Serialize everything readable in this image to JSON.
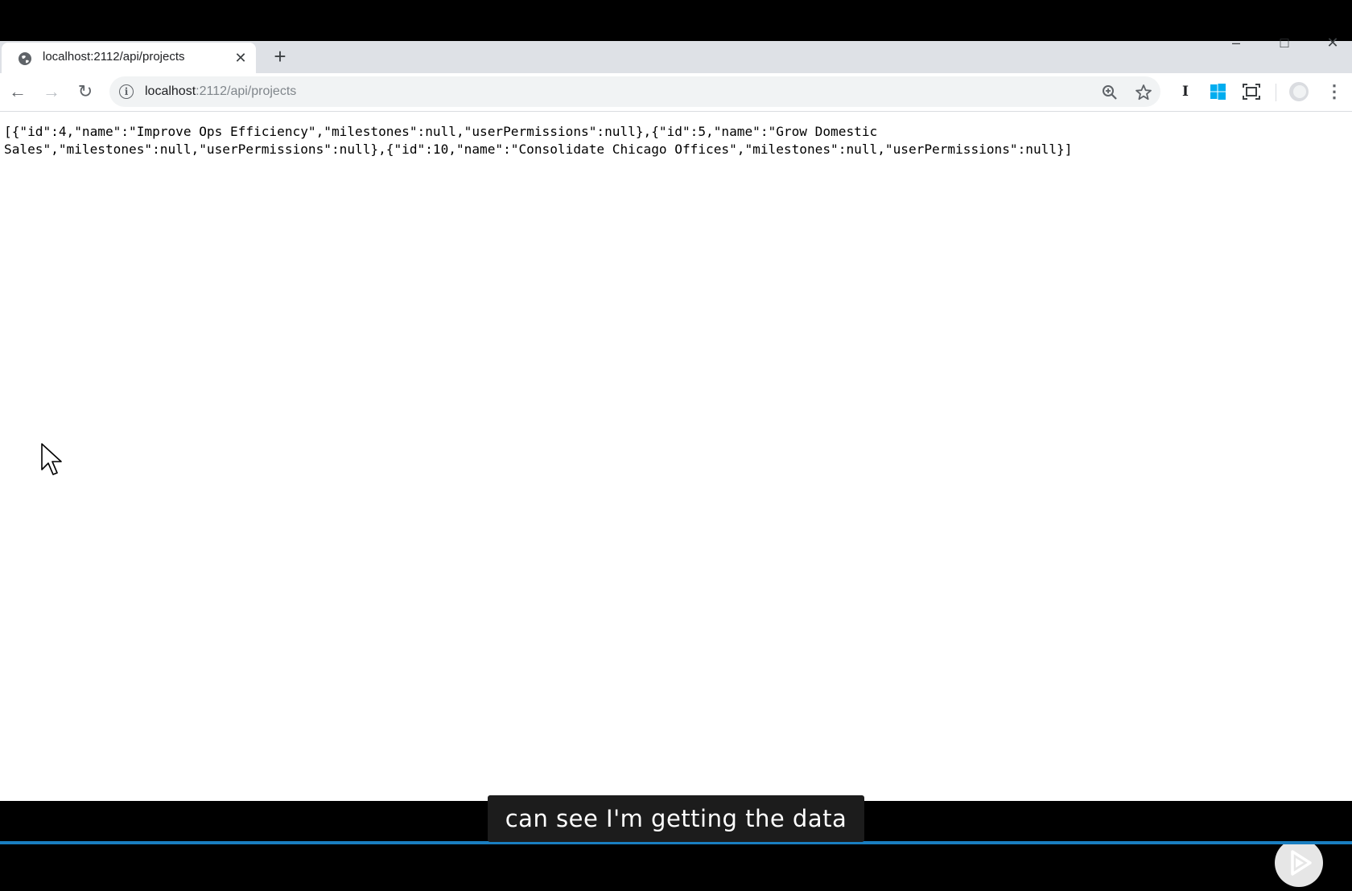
{
  "browser": {
    "tab": {
      "title": "localhost:2112/api/projects",
      "close_glyph": "✕",
      "favicon": "globe-icon"
    },
    "new_tab_glyph": "+",
    "window_controls": {
      "minimize": "–",
      "maximize": "□",
      "close": "✕"
    },
    "nav": {
      "back": "←",
      "forward": "→",
      "reload": "↻"
    },
    "address": {
      "host": "localhost",
      "path": ":2112/api/projects",
      "info_glyph": "i"
    },
    "extensions": {
      "ext_i_label": "I"
    }
  },
  "page": {
    "json_text": "[{\"id\":4,\"name\":\"Improve Ops Efficiency\",\"milestones\":null,\"userPermissions\":null},{\"id\":5,\"name\":\"Grow Domestic\nSales\",\"milestones\":null,\"userPermissions\":null},{\"id\":10,\"name\":\"Consolidate Chicago Offices\",\"milestones\":null,\"userPermissions\":null}]"
  },
  "video": {
    "caption": "can see I'm getting the data"
  },
  "colors": {
    "accent": "#1a7ec0",
    "windows_blue": "#00adef"
  }
}
